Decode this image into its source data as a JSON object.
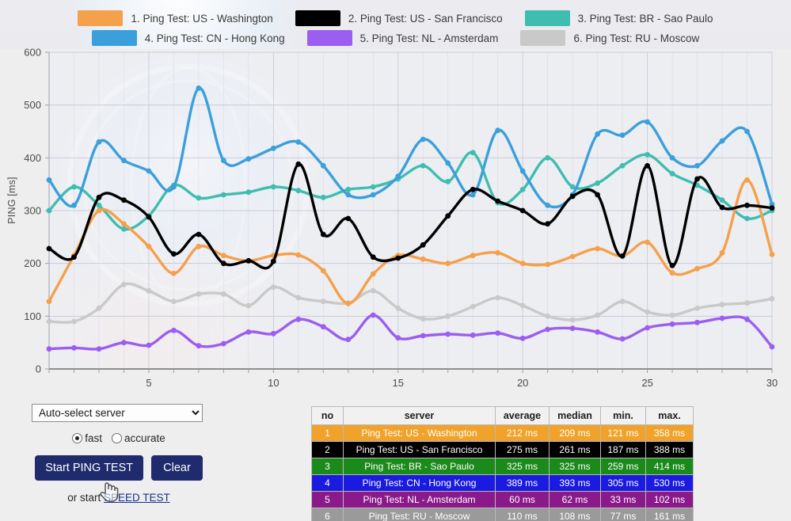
{
  "legend": {
    "items": [
      {
        "label": "1. Ping Test: US - Washington",
        "color": "#f5a04a"
      },
      {
        "label": "2. Ping Test: US - San Francisco",
        "color": "#000000"
      },
      {
        "label": "3. Ping Test: BR - Sao Paulo",
        "color": "#3fbdb0"
      },
      {
        "label": "4. Ping Test: CN - Hong Kong",
        "color": "#3b9fdb"
      },
      {
        "label": "5. Ping Test: NL - Amsterdam",
        "color": "#9b5ef0"
      },
      {
        "label": "6. Ping Test: RU - Moscow",
        "color": "#c9c9c9"
      }
    ]
  },
  "chart_data": {
    "type": "line",
    "title": "",
    "xlabel": "",
    "ylabel": "PING [ms]",
    "xlim": [
      1,
      30
    ],
    "ylim": [
      0,
      600
    ],
    "yticks": [
      0,
      100,
      200,
      300,
      400,
      500,
      600
    ],
    "xticks": [
      5,
      10,
      15,
      20,
      25,
      30
    ],
    "grid": true,
    "legend_position": "top",
    "x": [
      1,
      2,
      3,
      4,
      5,
      6,
      7,
      8,
      9,
      10,
      11,
      12,
      13,
      14,
      15,
      16,
      17,
      18,
      19,
      20,
      21,
      22,
      23,
      24,
      25,
      26,
      27,
      28,
      29,
      30
    ],
    "series": [
      {
        "name": "1. Ping Test: US - Washington",
        "color": "#f5a04a",
        "values": [
          128,
          215,
          300,
          275,
          232,
          181,
          232,
          215,
          205,
          215,
          216,
          186,
          124,
          180,
          215,
          208,
          200,
          215,
          220,
          200,
          198,
          213,
          228,
          214,
          240,
          182,
          190,
          220,
          358,
          217
        ]
      },
      {
        "name": "2. Ping Test: US - San Francisco",
        "color": "#000000",
        "values": [
          228,
          212,
          325,
          320,
          288,
          218,
          255,
          200,
          205,
          204,
          388,
          255,
          285,
          212,
          210,
          235,
          290,
          340,
          318,
          300,
          275,
          327,
          330,
          214,
          385,
          196,
          360,
          306,
          310,
          305
        ]
      },
      {
        "name": "3. Ping Test: BR - Sao Paulo",
        "color": "#3fbdb0",
        "values": [
          300,
          345,
          310,
          265,
          290,
          348,
          324,
          330,
          335,
          345,
          338,
          325,
          340,
          345,
          360,
          385,
          355,
          410,
          315,
          340,
          400,
          345,
          352,
          385,
          406,
          370,
          348,
          320,
          285,
          300
        ]
      },
      {
        "name": "4. Ping Test: CN - Hong Kong",
        "color": "#3b9fdb",
        "values": [
          358,
          310,
          430,
          395,
          375,
          345,
          532,
          395,
          398,
          418,
          430,
          385,
          330,
          330,
          365,
          435,
          390,
          330,
          452,
          375,
          310,
          330,
          445,
          443,
          468,
          400,
          385,
          432,
          450,
          312
        ]
      },
      {
        "name": "5. Ping Test: NL - Amsterdam",
        "color": "#9b5ef0",
        "values": [
          38,
          40,
          38,
          50,
          45,
          73,
          44,
          48,
          70,
          67,
          94,
          80,
          56,
          102,
          59,
          63,
          66,
          64,
          68,
          58,
          75,
          77,
          70,
          57,
          78,
          85,
          88,
          96,
          94,
          42
        ]
      },
      {
        "name": "6. Ping Test: RU - Moscow",
        "color": "#c9c9c9",
        "values": [
          90,
          90,
          115,
          160,
          148,
          128,
          142,
          142,
          120,
          155,
          135,
          128,
          125,
          148,
          115,
          95,
          100,
          118,
          135,
          120,
          100,
          93,
          102,
          128,
          108,
          102,
          115,
          122,
          125,
          133
        ]
      }
    ]
  },
  "controls": {
    "server_select": {
      "value": "Auto-select server",
      "options": [
        "Auto-select server"
      ]
    },
    "mode": {
      "fast_label": "fast",
      "accurate_label": "accurate",
      "selected": "fast"
    },
    "start_button": "Start PING TEST",
    "clear_button": "Clear",
    "footer_prefix": "or start ",
    "footer_link": "SPEED TEST"
  },
  "table": {
    "headers": [
      "no",
      "server",
      "average",
      "median",
      "min.",
      "max."
    ],
    "rows": [
      {
        "no": "1",
        "server": "Ping Test: US - Washington",
        "average": "212 ms",
        "median": "209 ms",
        "min": "121 ms",
        "max": "358 ms",
        "bg": "#f0a22a",
        "fg": "#ffffff"
      },
      {
        "no": "2",
        "server": "Ping Test: US - San Francisco",
        "average": "275 ms",
        "median": "261 ms",
        "min": "187 ms",
        "max": "388 ms",
        "bg": "#000000",
        "fg": "#ffffff"
      },
      {
        "no": "3",
        "server": "Ping Test: BR - Sao Paulo",
        "average": "325 ms",
        "median": "325 ms",
        "min": "259 ms",
        "max": "414 ms",
        "bg": "#1a8a1a",
        "fg": "#ffffff"
      },
      {
        "no": "4",
        "server": "Ping Test: CN - Hong Kong",
        "average": "389 ms",
        "median": "393 ms",
        "min": "305 ms",
        "max": "530 ms",
        "bg": "#1a1ae0",
        "fg": "#ffffff"
      },
      {
        "no": "5",
        "server": "Ping Test: NL - Amsterdam",
        "average": "60 ms",
        "median": "62 ms",
        "min": "33 ms",
        "max": "102 ms",
        "bg": "#8a1a8a",
        "fg": "#ffffff"
      },
      {
        "no": "6",
        "server": "Ping Test: RU - Moscow",
        "average": "110 ms",
        "median": "108 ms",
        "min": "77 ms",
        "max": "161 ms",
        "bg": "#9a9a9a",
        "fg": "#ffffff"
      }
    ]
  }
}
